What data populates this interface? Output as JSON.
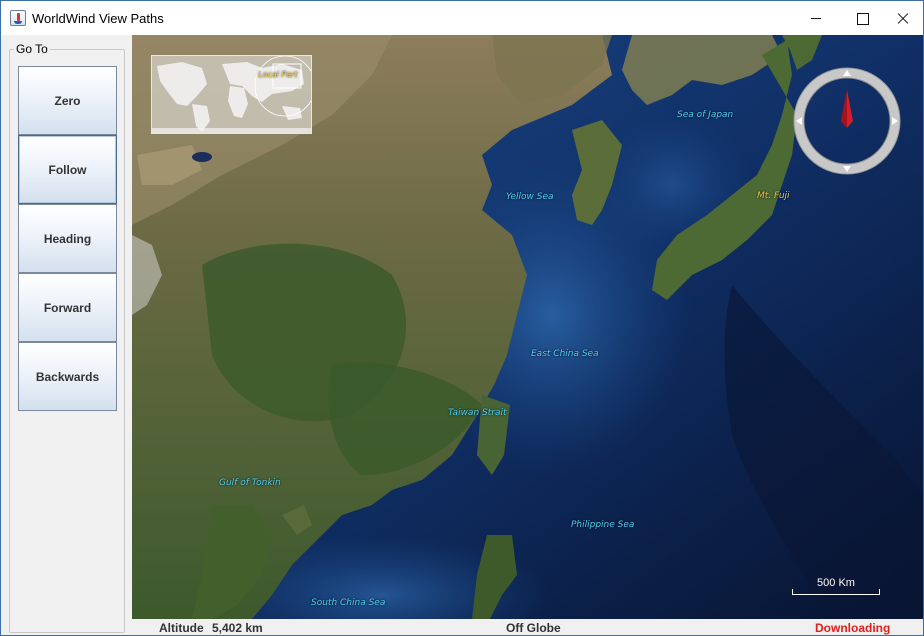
{
  "window": {
    "title": "WorldWind View Paths",
    "icon": "java-cup-icon",
    "controls": [
      "minimize-icon",
      "maximize-icon",
      "close-icon"
    ]
  },
  "sidebar": {
    "group_label": "Go To",
    "buttons": [
      {
        "label": "Zero"
      },
      {
        "label": "Follow"
      },
      {
        "label": "Heading"
      },
      {
        "label": "Forward"
      },
      {
        "label": "Backwards"
      }
    ]
  },
  "globe": {
    "minimap_label": "Local Part",
    "labels": {
      "sea_of_japan": "Sea of Japan",
      "yellow_sea": "Yellow Sea",
      "mt_fuji": "Mt. Fuji",
      "east_china_sea": "East China Sea",
      "taiwan_strait": "Taiwan Strait",
      "gulf_of_tonkin": "Gulf of Tonkin",
      "philippine_sea": "Philippine Sea",
      "south_china_sea": "South China Sea"
    },
    "scale": "500 Km",
    "compass": "compass-icon"
  },
  "status": {
    "altitude_label": "Altitude",
    "altitude_value": "5,402 km",
    "position": "Off Globe",
    "download": "Downloading"
  },
  "colors": {
    "water_label": "#4fd0f2",
    "land_label": "#e8c64a",
    "downloading": "#e02020",
    "compass_needle": "#d21f2b",
    "window_border": "#3a6ea5"
  }
}
